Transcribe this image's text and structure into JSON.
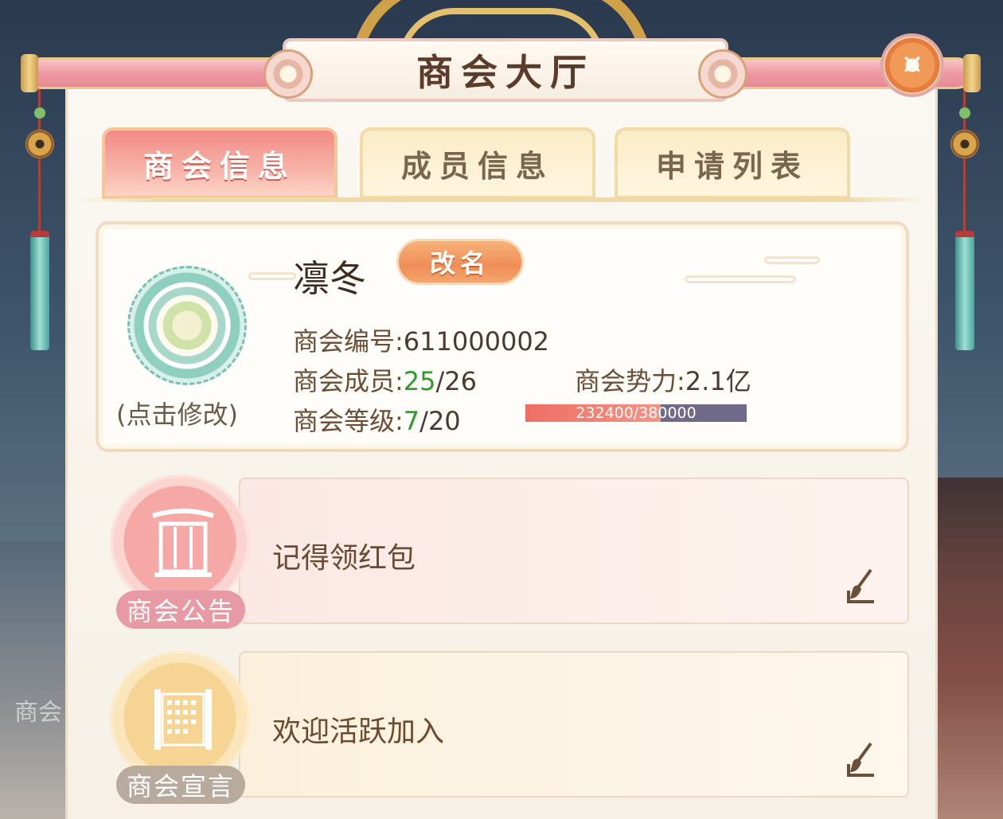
{
  "window": {
    "title": "商会大厅"
  },
  "tabs": [
    {
      "label": "商会信息",
      "active": true
    },
    {
      "label": "成员信息",
      "active": false
    },
    {
      "label": "申请列表",
      "active": false
    }
  ],
  "guild": {
    "name": "凛冬",
    "rename_label": "改名",
    "emblem_caption": "(点击修改)",
    "id_label": "商会编号:",
    "id_value": "611000002",
    "members_label": "商会成员:",
    "members_current": "25",
    "members_sep_max": "/26",
    "power_label": "商会势力:",
    "power_value": "2.1亿",
    "level_label": "商会等级:",
    "level_current": "7",
    "level_sep_max": "/20",
    "exp_text": "232400/380000",
    "exp_fraction": 0.61
  },
  "notice": {
    "badge_label": "商会公告",
    "text": "记得领红包"
  },
  "declaration": {
    "badge_label": "商会宣言",
    "text": "欢迎活跃加入"
  },
  "background_text": "商会",
  "colors": {
    "accent_pink": "#f28a86",
    "green_value": "#2e9a2a",
    "exp_fill": "#ee6e64",
    "exp_track": "#6f6a8a"
  }
}
